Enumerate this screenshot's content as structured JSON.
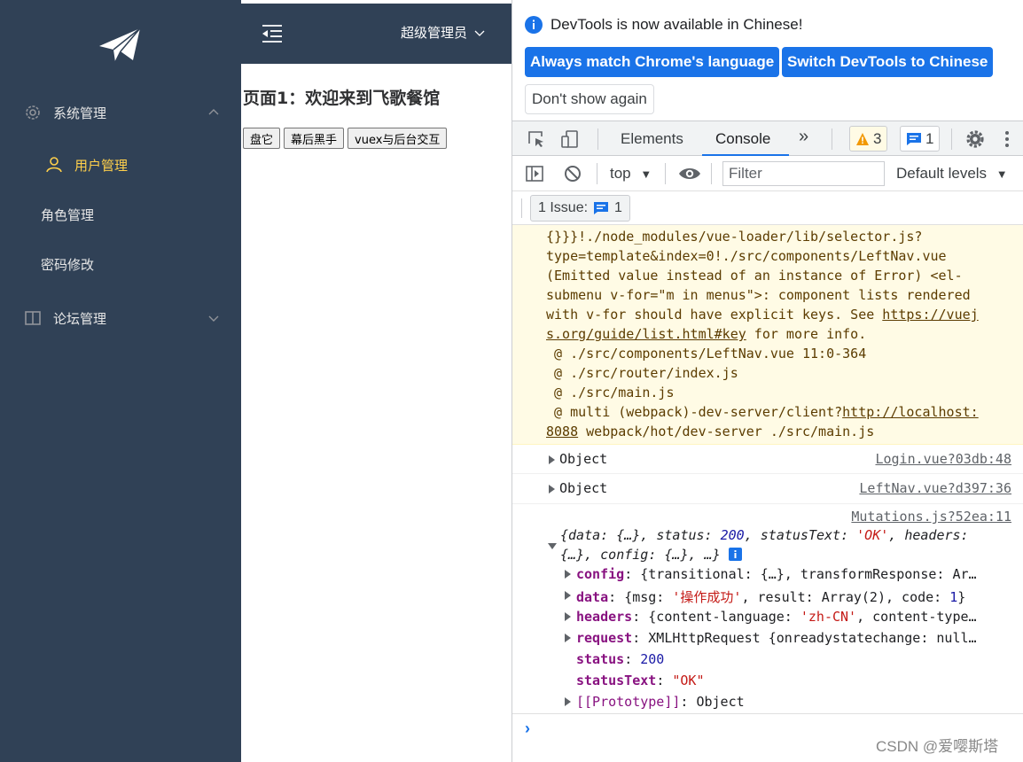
{
  "app": {
    "header": {
      "user_name": "超级管理员"
    },
    "sidebar": {
      "menus": [
        {
          "label": "系统管理",
          "icon": "gear-icon",
          "expanded": true
        },
        {
          "label": "用户管理",
          "icon": "user-icon",
          "active": true
        },
        {
          "label": "角色管理"
        },
        {
          "label": "密码修改"
        },
        {
          "label": "论坛管理",
          "icon": "book-icon",
          "expanded": false
        }
      ]
    },
    "page": {
      "title": "页面1：欢迎来到飞歌餐馆",
      "buttons": [
        "盘它",
        "幕后黑手",
        "vuex与后台交互"
      ]
    },
    "colors": {
      "sidebar_bg": "#304156",
      "active_menu": "#ffd04b"
    }
  },
  "devtools": {
    "banner": {
      "message": "DevTools is now available in Chinese!",
      "btn_match": "Always match Chrome's language",
      "btn_switch": "Switch DevTools to Chinese",
      "btn_dont_show": "Don't show again"
    },
    "tabs": {
      "elements": "Elements",
      "console": "Console",
      "more": "»"
    },
    "badges": {
      "warnings": "3",
      "messages": "1"
    },
    "toolbar": {
      "context": "top",
      "filter_placeholder": "Filter",
      "levels": "Default levels"
    },
    "issues": {
      "label": "1 Issue:",
      "count": "1"
    },
    "warning": {
      "lines": [
        "{}}}!./node_modules/vue-loader/lib/selector.js?",
        "type=template&index=0!./src/components/LeftNav.vue",
        "(Emitted value instead of an instance of Error) <el-",
        "submenu v-for=\"m in menus\">: component lists rendered",
        "with v-for should have explicit keys. See "
      ],
      "link1a": "https://vuej",
      "link1b": "s.org/guide/list.html#key",
      "link1_tail": " for more info.",
      "stack1": " @ ./src/components/LeftNav.vue 11:0-364",
      "stack2": " @ ./src/router/index.js",
      "stack3": " @ ./src/main.js",
      "stack4_head": " @ multi (webpack)-dev-server/client?",
      "stack4_link_a": "http://localhost:",
      "stack4_link_b": "8088",
      "stack4_tail": " webpack/hot/dev-server ./src/main.js"
    },
    "logs": [
      {
        "text": "Object",
        "source": "Login.vue?03db:48"
      },
      {
        "text": "Object",
        "source": "LeftNav.vue?d397:36"
      }
    ],
    "response": {
      "source": "Mutations.js?52ea:11",
      "summary_line1_a": "{data: {…}, status: ",
      "summary_status": "200",
      "summary_line1_b": ", statusText: ",
      "summary_statustext": "'OK'",
      "summary_line1_c": ", headers:",
      "summary_line2": "{…}, config: {…}, …}",
      "props": [
        {
          "key": "config",
          "value": "{transitional: {…}, transformResponse: Ar…"
        },
        {
          "key": "data",
          "value_a": "{msg: ",
          "value_str": "'操作成功'",
          "value_b": ", result: Array(2), code: ",
          "value_num": "1",
          "value_c": "}"
        },
        {
          "key": "headers",
          "value_a": "{content-language: ",
          "value_str": "'zh-CN'",
          "value_b": ", content-type…"
        },
        {
          "key": "request",
          "value": "XMLHttpRequest {onreadystatechange: null…"
        },
        {
          "key": "status",
          "value": "200"
        },
        {
          "key": "statusText",
          "value": "\"OK\""
        },
        {
          "key": "[[Prototype]]",
          "value": "Object"
        }
      ]
    },
    "prompt": "›",
    "watermark": "CSDN @爱嘤斯塔"
  }
}
